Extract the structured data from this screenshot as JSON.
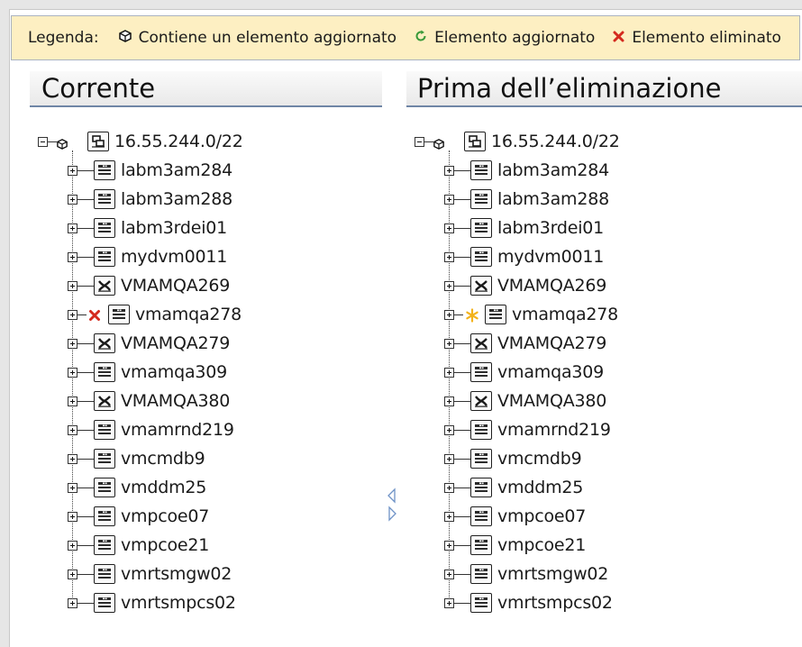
{
  "legend": {
    "title": "Legenda:",
    "items": [
      {
        "icon": "package-icon",
        "label": "Contiene un elemento aggiornato"
      },
      {
        "icon": "refresh-icon",
        "label": "Elemento aggiornato"
      },
      {
        "icon": "delete-x-icon",
        "label": "Elemento eliminato"
      }
    ]
  },
  "panels": [
    {
      "title": "Corrente",
      "root": {
        "label": "16.55.244.0/22",
        "marker": "package-icon"
      },
      "children": [
        {
          "label": "labm3am284",
          "icon": "windows-server-icon"
        },
        {
          "label": "labm3am288",
          "icon": "windows-server-icon"
        },
        {
          "label": "labm3rdei01",
          "icon": "windows-server-icon"
        },
        {
          "label": "mydvm0011",
          "icon": "windows-server-icon"
        },
        {
          "label": "VMAMQA269",
          "icon": "unix-server-icon"
        },
        {
          "label": "vmamqa278",
          "icon": "windows-server-icon",
          "marker": "delete-x-icon"
        },
        {
          "label": "VMAMQA279",
          "icon": "unix-server-icon"
        },
        {
          "label": "vmamqa309",
          "icon": "windows-server-icon"
        },
        {
          "label": "VMAMQA380",
          "icon": "unix-server-icon"
        },
        {
          "label": "vmamrnd219",
          "icon": "windows-server-icon"
        },
        {
          "label": "vmcmdb9",
          "icon": "windows-server-icon"
        },
        {
          "label": "vmddm25",
          "icon": "windows-server-icon"
        },
        {
          "label": "vmpcoe07",
          "icon": "windows-server-icon"
        },
        {
          "label": "vmpcoe21",
          "icon": "windows-server-icon"
        },
        {
          "label": "vmrtsmgw02",
          "icon": "windows-server-icon"
        },
        {
          "label": "vmrtsmpcs02",
          "icon": "windows-server-icon"
        }
      ]
    },
    {
      "title": "Prima dell’eliminazione",
      "root": {
        "label": "16.55.244.0/22",
        "marker": "package-icon"
      },
      "children": [
        {
          "label": "labm3am284",
          "icon": "windows-server-icon"
        },
        {
          "label": "labm3am288",
          "icon": "windows-server-icon"
        },
        {
          "label": "labm3rdei01",
          "icon": "windows-server-icon"
        },
        {
          "label": "mydvm0011",
          "icon": "windows-server-icon"
        },
        {
          "label": "VMAMQA269",
          "icon": "unix-server-icon"
        },
        {
          "label": "vmamqa278",
          "icon": "windows-server-icon",
          "marker": "asterisk-icon"
        },
        {
          "label": "VMAMQA279",
          "icon": "unix-server-icon"
        },
        {
          "label": "vmamqa309",
          "icon": "windows-server-icon"
        },
        {
          "label": "VMAMQA380",
          "icon": "unix-server-icon"
        },
        {
          "label": "vmamrnd219",
          "icon": "windows-server-icon"
        },
        {
          "label": "vmcmdb9",
          "icon": "windows-server-icon"
        },
        {
          "label": "vmddm25",
          "icon": "windows-server-icon"
        },
        {
          "label": "vmpcoe07",
          "icon": "windows-server-icon"
        },
        {
          "label": "vmpcoe21",
          "icon": "windows-server-icon"
        },
        {
          "label": "vmrtsmgw02",
          "icon": "windows-server-icon"
        },
        {
          "label": "vmrtsmpcs02",
          "icon": "windows-server-icon"
        }
      ]
    }
  ],
  "colors": {
    "legend_bg": "#fdefc2",
    "header_underline": "#6f86a6",
    "deleted_marker": "#d42a1e",
    "added_marker": "#f2b21b",
    "updated_marker": "#3a9a3a"
  }
}
